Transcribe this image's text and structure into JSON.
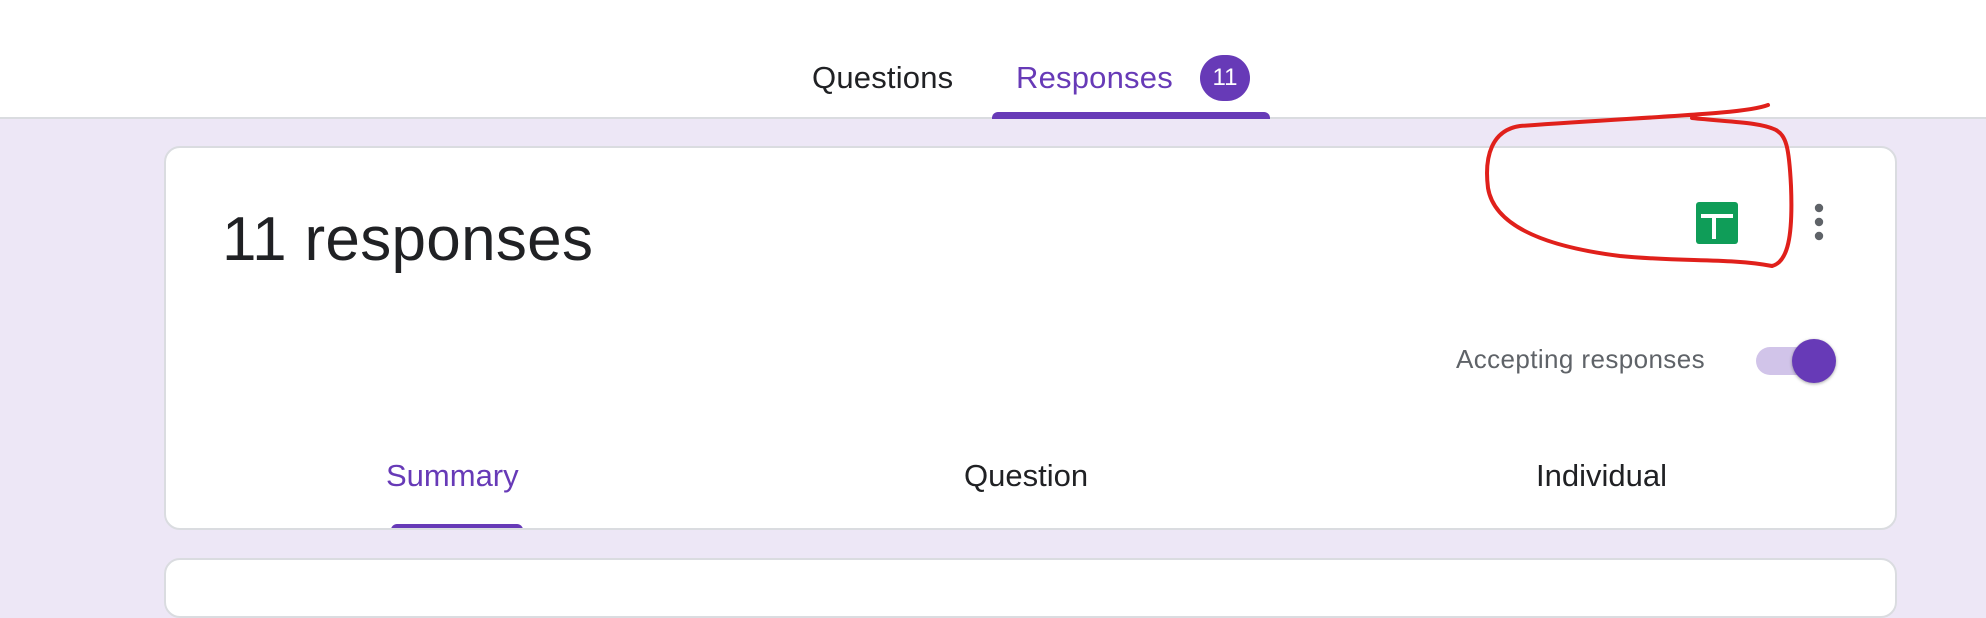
{
  "top_tabs": {
    "questions_label": "Questions",
    "responses_label": "Responses",
    "responses_count": "11"
  },
  "summary_card": {
    "title": "11 responses",
    "accepting_label": "Accepting responses",
    "accepting_enabled": true,
    "sheets_icon": "google-sheets-icon",
    "more_icon": "more-vert-icon",
    "tabs": [
      {
        "label": "Summary",
        "selected": true
      },
      {
        "label": "Question",
        "selected": false
      },
      {
        "label": "Individual",
        "selected": false
      }
    ]
  },
  "colors": {
    "accent": "#673ab7",
    "page_background": "#ede7f6",
    "sheets_green": "#0f9d58",
    "annotation_red": "#e0201b"
  }
}
